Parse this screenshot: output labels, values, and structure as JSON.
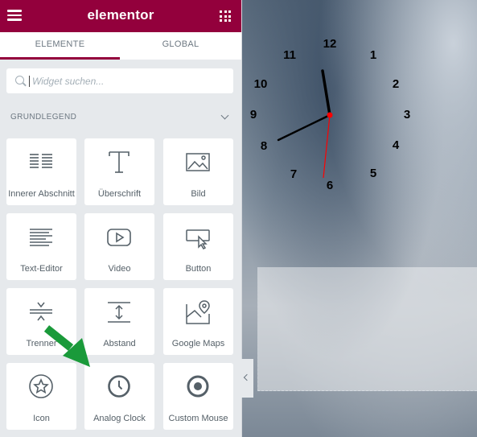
{
  "app": {
    "brand": "elementor"
  },
  "tabs": [
    {
      "label": "ELEMENTE"
    },
    {
      "label": "GLOBAL"
    }
  ],
  "search": {
    "placeholder": "Widget suchen..."
  },
  "category": {
    "label": "GRUNDLEGEND"
  },
  "widgets": [
    {
      "label": "Innerer Abschnitt",
      "icon": "inner-section-icon"
    },
    {
      "label": "Überschrift",
      "icon": "heading-icon"
    },
    {
      "label": "Bild",
      "icon": "image-icon"
    },
    {
      "label": "Text-Editor",
      "icon": "text-editor-icon"
    },
    {
      "label": "Video",
      "icon": "video-icon"
    },
    {
      "label": "Button",
      "icon": "button-icon"
    },
    {
      "label": "Trenner",
      "icon": "divider-icon"
    },
    {
      "label": "Abstand",
      "icon": "spacer-icon"
    },
    {
      "label": "Google Maps",
      "icon": "google-maps-icon"
    },
    {
      "label": "Icon",
      "icon": "star-icon"
    },
    {
      "label": "Analog Clock",
      "icon": "clock-icon"
    },
    {
      "label": "Custom Mouse",
      "icon": "target-icon"
    }
  ],
  "clock": {
    "numerals": [
      "12",
      "1",
      "2",
      "3",
      "4",
      "5",
      "6",
      "7",
      "8",
      "9",
      "10",
      "11"
    ],
    "hand_color": "#000000",
    "second_hand_color": "#ff0000"
  },
  "colors": {
    "brand": "#93003c",
    "arrow": "#1a9a3a",
    "panel": "#e6e9ec"
  }
}
